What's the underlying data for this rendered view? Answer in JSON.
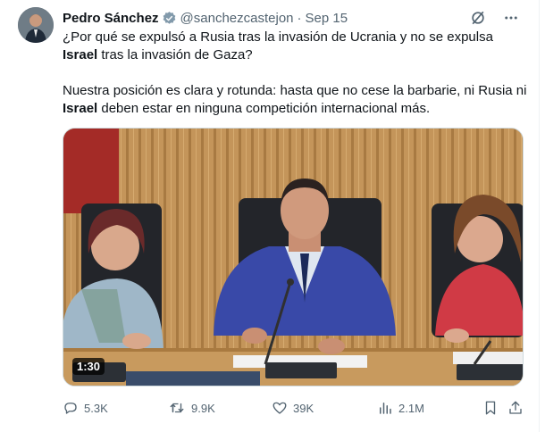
{
  "author": {
    "name": "Pedro Sánchez",
    "handle": "@sanchezcastejon",
    "separator": "·",
    "date": "Sep 15"
  },
  "tweet": {
    "p1_a": "¿Por qué se expulsó a Rusia tras la invasión de Ucrania y no se expulsa ",
    "p1_bold": "Israel",
    "p1_b": " tras la invasión de Gaza?",
    "p2_a": "Nuestra posición es clara y rotunda: hasta que no cese la barbarie, ni Rusia ni ",
    "p2_bold": "Israel",
    "p2_b": " deben estar en ninguna competición internacional más."
  },
  "media": {
    "duration": "1:30"
  },
  "actions": {
    "replies": "5.3K",
    "reposts": "9.9K",
    "likes": "39K",
    "views": "2.1M"
  },
  "icons": {
    "verified": "verified-badge-icon",
    "grok": "grok-icon",
    "more": "more-icon",
    "reply": "reply-icon",
    "repost": "repost-icon",
    "like": "like-icon",
    "views": "views-icon",
    "bookmark": "bookmark-icon",
    "share": "share-icon"
  },
  "colors": {
    "text": "#0f1419",
    "secondary": "#536471",
    "verified": "#829aab"
  }
}
